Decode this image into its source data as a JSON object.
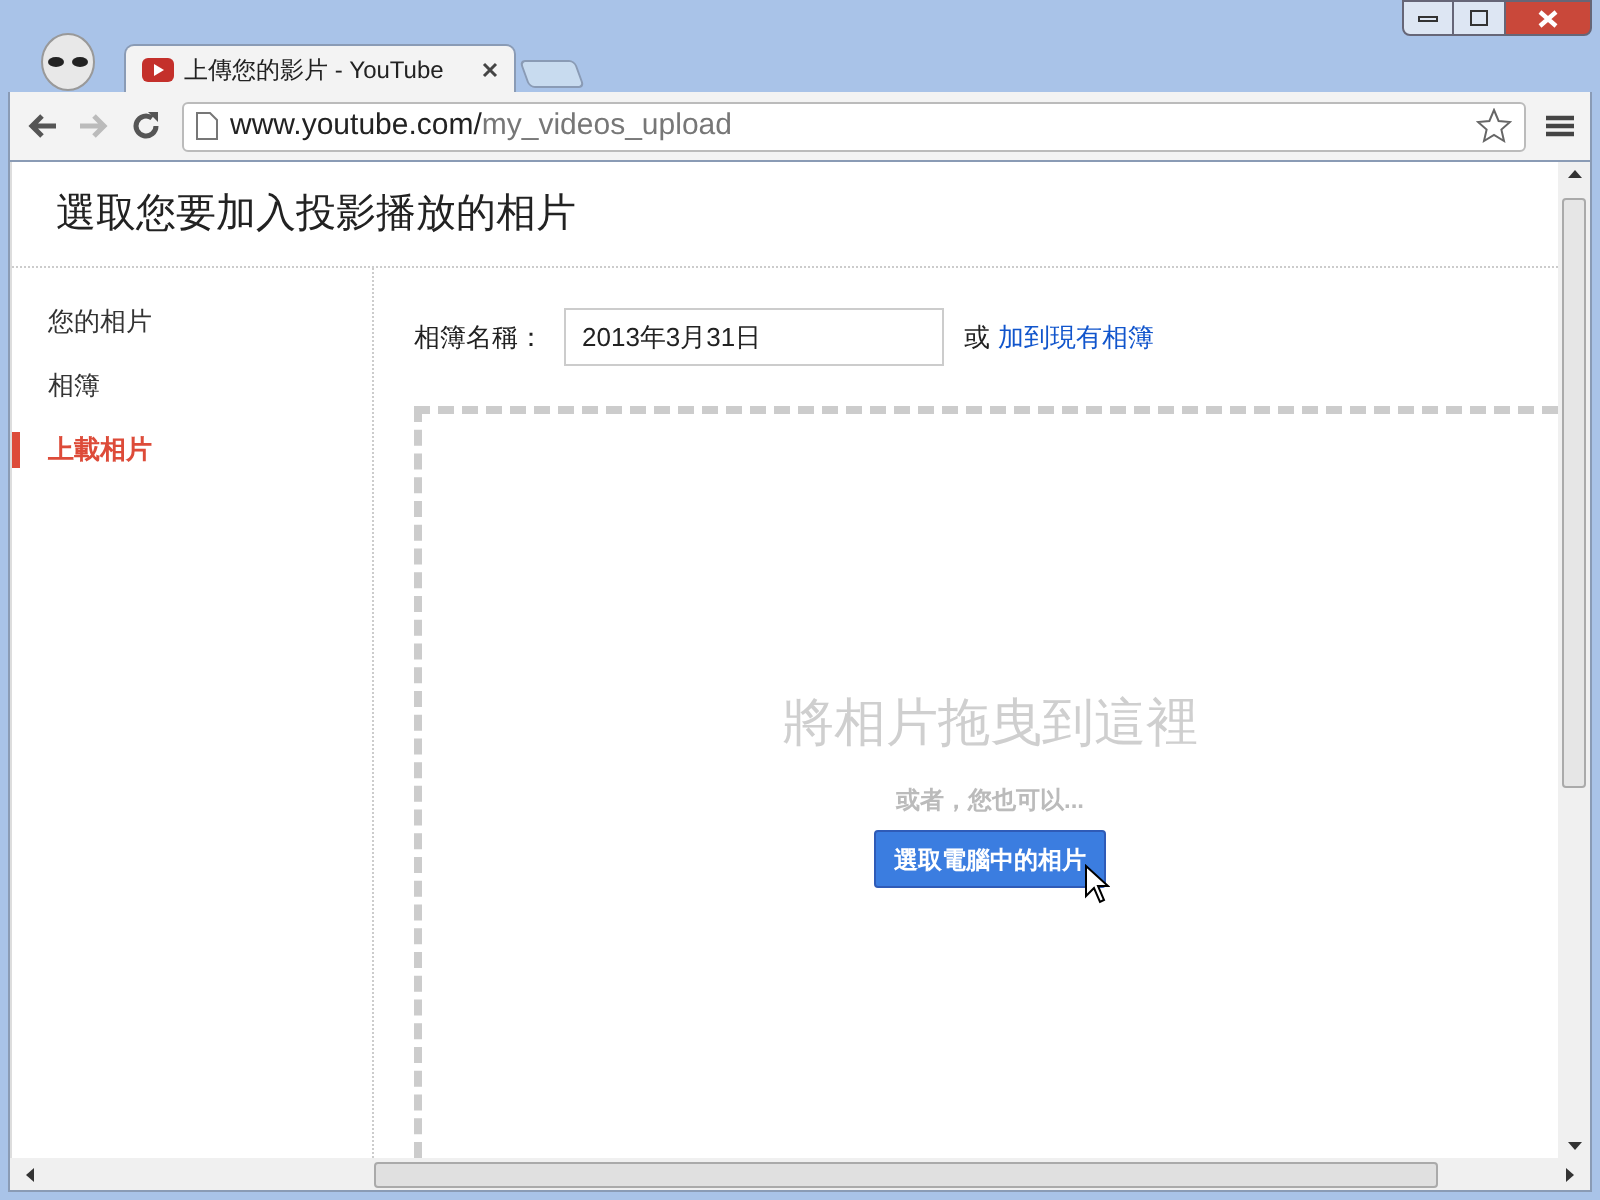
{
  "browser": {
    "tab": {
      "title": "上傳您的影片 - YouTube"
    },
    "url": {
      "host": "www.youtube.com/",
      "path": "my_videos_upload"
    }
  },
  "page": {
    "title": "選取您要加入投影播放的相片"
  },
  "sidebar": {
    "items": [
      {
        "label": "您的相片",
        "selected": false
      },
      {
        "label": "相簿",
        "selected": false
      },
      {
        "label": "上載相片",
        "selected": true
      }
    ]
  },
  "album": {
    "label": "相簿名稱：",
    "value": "2013年3月31日",
    "or": "或",
    "link": "加到現有相簿"
  },
  "dropzone": {
    "title": "將相片拖曳到這裡",
    "subtitle": "或者，您也可以...",
    "button": "選取電腦中的相片"
  }
}
